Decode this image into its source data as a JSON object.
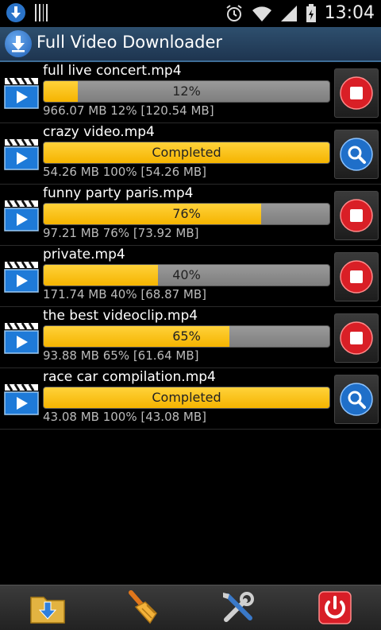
{
  "status_bar": {
    "time": "13:04"
  },
  "app": {
    "title": "Full Video Downloader"
  },
  "downloads": [
    {
      "filename": "full live concert.mp4",
      "progress_label": "12%",
      "progress": 12,
      "info": "966.07 MB 12% [120.54 MB]",
      "action": "stop"
    },
    {
      "filename": "crazy video.mp4",
      "progress_label": "Completed",
      "progress": 100,
      "info": "54.26 MB 100% [54.26 MB]",
      "action": "search"
    },
    {
      "filename": "funny party paris.mp4",
      "progress_label": "76%",
      "progress": 76,
      "info": "97.21 MB 76% [73.92 MB]",
      "action": "stop"
    },
    {
      "filename": "private.mp4",
      "progress_label": "40%",
      "progress": 40,
      "info": "171.74 MB 40% [68.87 MB]",
      "action": "stop"
    },
    {
      "filename": "the best videoclip.mp4",
      "progress_label": "65%",
      "progress": 65,
      "info": "93.88 MB 65% [61.64 MB]",
      "action": "stop"
    },
    {
      "filename": "race car compilation.mp4",
      "progress_label": "Completed",
      "progress": 100,
      "info": "43.08 MB 100% [43.08 MB]",
      "action": "search"
    }
  ],
  "toolbar_icons": [
    "folder-download-icon",
    "broom-icon",
    "tools-icon",
    "power-icon"
  ],
  "colors": {
    "progress_fill": "#f5b400",
    "action_bar": "#2e4f6e",
    "stop_red": "#d91f26",
    "search_blue": "#1f6fc9"
  }
}
